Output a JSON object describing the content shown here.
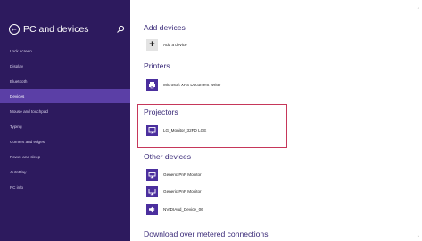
{
  "sidebar": {
    "title": "PC and devices",
    "items": [
      {
        "label": "Lock screen"
      },
      {
        "label": "Display"
      },
      {
        "label": "Bluetooth"
      },
      {
        "label": "Devices"
      },
      {
        "label": "Mouse and touchpad"
      },
      {
        "label": "Typing"
      },
      {
        "label": "Corners and edges"
      },
      {
        "label": "Power and sleep"
      },
      {
        "label": "AutoPlay"
      },
      {
        "label": "PC info"
      }
    ],
    "selected_index": 3
  },
  "main": {
    "add_devices": {
      "title": "Add devices",
      "add_label": "Add a device"
    },
    "printers": {
      "title": "Printers",
      "items": [
        {
          "label": "Microsoft XPS Document Writer",
          "icon": "printer-icon"
        }
      ]
    },
    "projectors": {
      "title": "Projectors",
      "items": [
        {
          "label": "LG_Monitor_32FD LGE",
          "icon": "monitor-icon"
        }
      ]
    },
    "other_devices": {
      "title": "Other devices",
      "items": [
        {
          "label": "Generic PnP Monitor",
          "icon": "monitor-icon"
        },
        {
          "label": "Generic PnP Monitor",
          "icon": "monitor-icon"
        },
        {
          "label": "NVIDIAud_Device_06",
          "icon": "speaker-icon"
        }
      ]
    },
    "metered": {
      "title": "Download over metered connections"
    }
  },
  "colors": {
    "sidebar_bg": "#2d1a5e",
    "selected_bg": "#5b3fa6",
    "accent": "#4b2f9e",
    "highlight": "#c6375a"
  }
}
